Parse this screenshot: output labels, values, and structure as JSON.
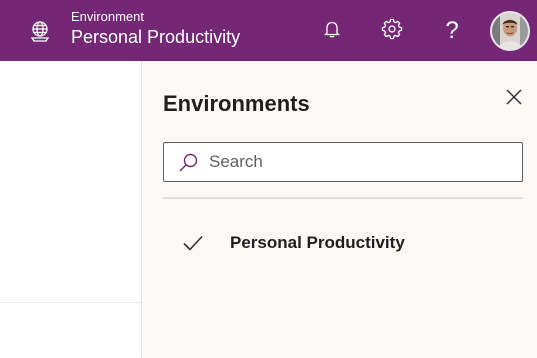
{
  "header": {
    "environment_label": "Environment",
    "environment_name": "Personal Productivity",
    "background_color": "#742774",
    "icons": {
      "environment": "globe-environment-icon",
      "notifications": "bell-icon",
      "settings": "gear-icon",
      "help": "?",
      "avatar": "user-avatar"
    }
  },
  "panel": {
    "title": "Environments",
    "close_icon": "close-icon",
    "search": {
      "placeholder": "Search",
      "value": ""
    },
    "items": [
      {
        "label": "Personal Productivity",
        "selected": true
      }
    ]
  }
}
